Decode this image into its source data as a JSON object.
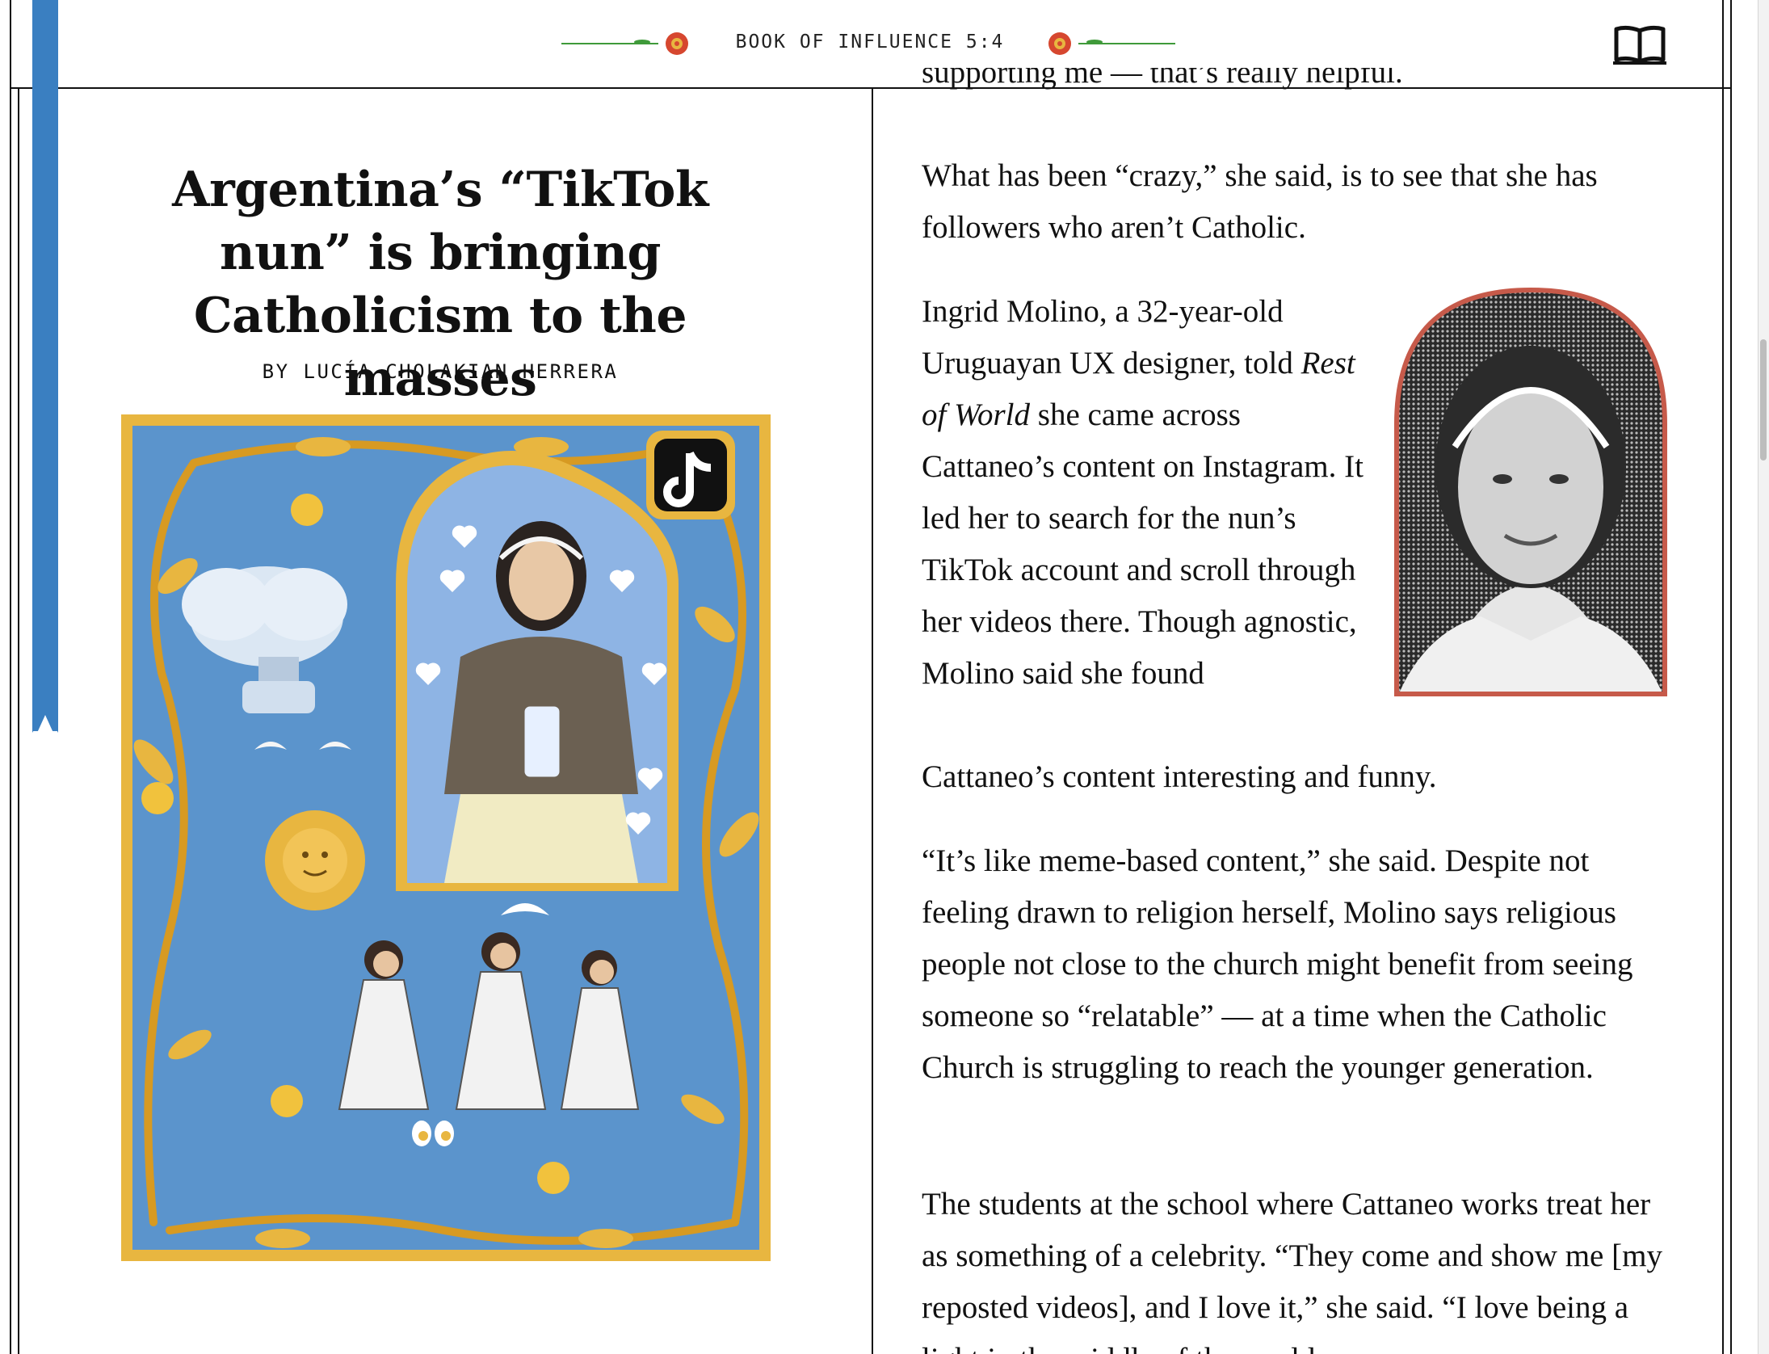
{
  "header": {
    "title": "BOOK OF INFLUENCE 5:4",
    "book_icon": "open-book-icon",
    "ornament_icon": "flower-ornament-icon",
    "ornament_colors": [
      "#d6472f",
      "#3f9a3a",
      "#e8b640"
    ]
  },
  "ribbon": {
    "color": "#3a7fc1"
  },
  "article": {
    "headline": "Argentina’s “TikTok nun” is bringing Catholicism to the masses",
    "byline": "BY LUCÍA CHOLAKIAN HERRERA",
    "illustration": {
      "description_icon": "illuminated-manuscript-illustration",
      "border_color": "#e8b640",
      "background_color": "#5b94cc",
      "tiktok_icon": "tiktok-logo-icon"
    }
  },
  "body": {
    "cut_line": "supporting me — that’s really helpful.",
    "p1": "What has been “crazy,” she said, is to see that she has followers who aren’t Catholic.",
    "p2_before_italic": "Ingrid Molino, a 32-year-old Uruguayan UX designer, told ",
    "p2_italic": "Rest of World",
    "p2_after_italic": " she came across Cattaneo’s content on Instagram. It led her to search for the nun’s TikTok account and scroll through her videos there. Though agnostic, Molino said she found",
    "p2_tail": "Cattaneo’s content interesting and funny.",
    "p3": "“It’s like meme-based content,” she said. Despite not feeling drawn to religion herself, Molino says religious people not close to the church might benefit from seeing someone so “relatable” — at a time when the Catholic Church is struggling to reach the younger generation.",
    "p4": "The students at the school where Cattaneo works treat her as something of a celebrity. “They come and show me [my reposted videos], and I love it,” she said. “I love being a light in the middle of the world."
  },
  "portrait": {
    "border_color": "#c65a4a"
  }
}
